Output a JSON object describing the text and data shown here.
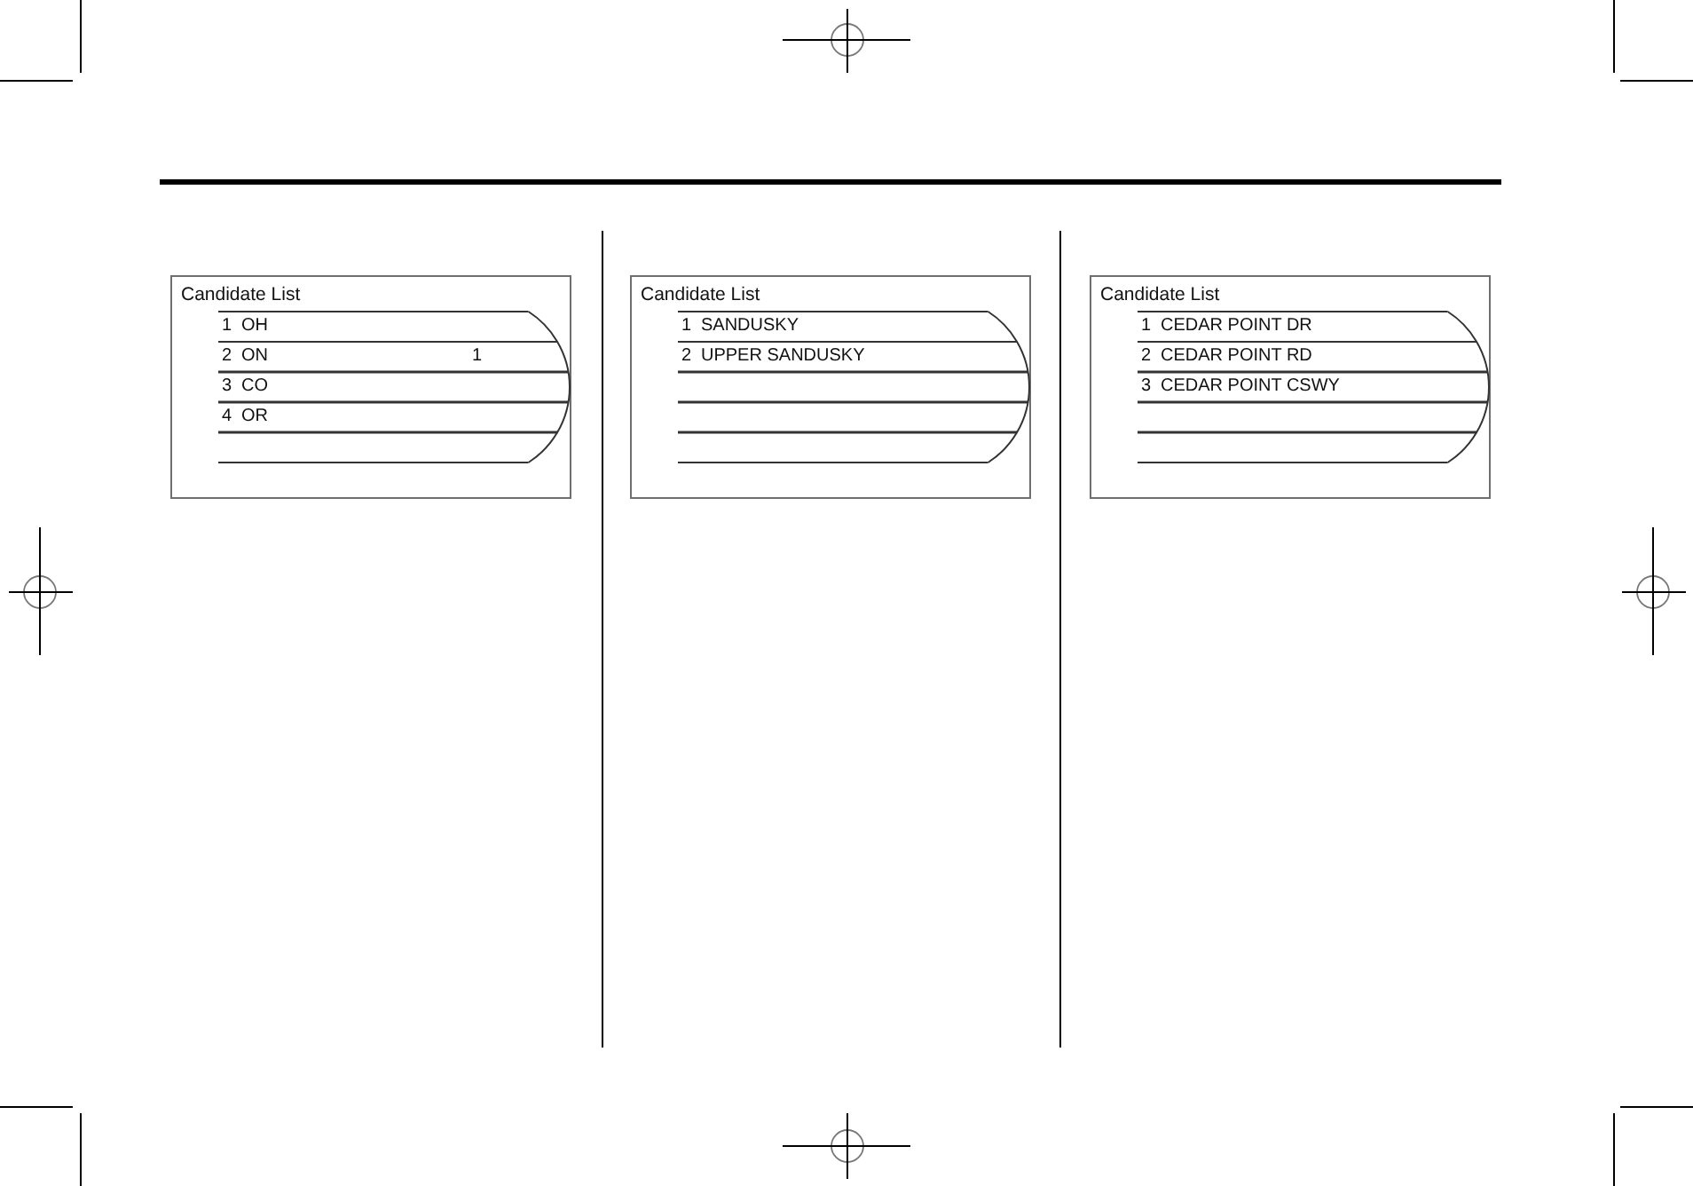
{
  "panels": [
    {
      "title": "Candidate List",
      "items": [
        {
          "number": "1",
          "name": "OH"
        },
        {
          "number": "2",
          "name": "ON",
          "trailing": "1"
        },
        {
          "number": "3",
          "name": "CO"
        },
        {
          "number": "4",
          "name": "OR"
        }
      ]
    },
    {
      "title": "Candidate List",
      "items": [
        {
          "number": "1",
          "name": "SANDUSKY"
        },
        {
          "number": "2",
          "name": "UPPER SANDUSKY"
        }
      ]
    },
    {
      "title": "Candidate List",
      "items": [
        {
          "number": "1",
          "name": "CEDAR POINT DR"
        },
        {
          "number": "2",
          "name": "CEDAR POINT RD"
        },
        {
          "number": "3",
          "name": "CEDAR POINT CSWY"
        }
      ]
    }
  ]
}
